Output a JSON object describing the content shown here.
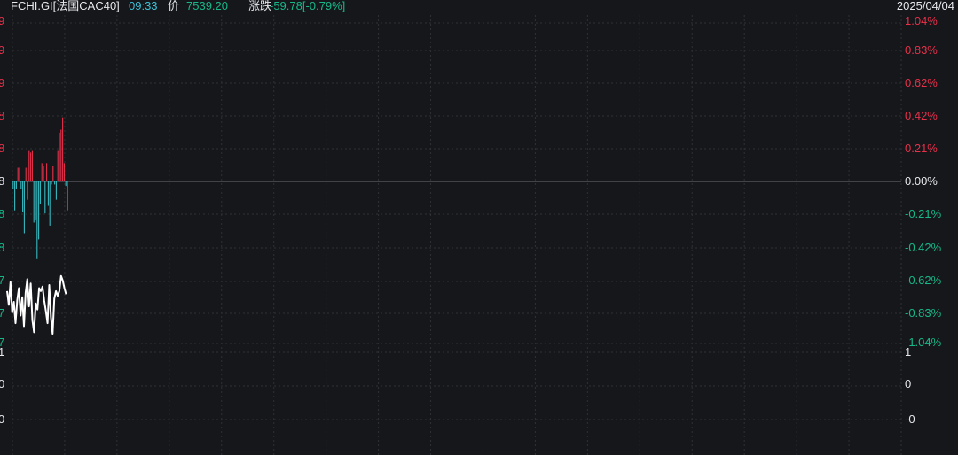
{
  "header": {
    "symbol": "FCHI.GI[法国CAC40]",
    "time": "09:33",
    "price_label": "价",
    "price": "7539.20",
    "change_label": "涨跌",
    "change": "-59.78[-0.79%]",
    "date": "2025/04/04"
  },
  "colors": {
    "background": "#16171b",
    "up": "#e8304a",
    "down": "#16b889",
    "down_bar": "#36b8c0",
    "time_text": "#3bc1d6",
    "line": "#ffffff",
    "grid": "#2e3036"
  },
  "axis": {
    "right_pct_labels": [
      {
        "text": "1.04%",
        "dir": "up"
      },
      {
        "text": "0.83%",
        "dir": "up"
      },
      {
        "text": "0.62%",
        "dir": "up"
      },
      {
        "text": "0.42%",
        "dir": "up"
      },
      {
        "text": "0.21%",
        "dir": "up"
      },
      {
        "text": "0.00%",
        "dir": "flat"
      },
      {
        "text": "-0.21%",
        "dir": "down"
      },
      {
        "text": "-0.42%",
        "dir": "down"
      },
      {
        "text": "-0.62%",
        "dir": "down"
      },
      {
        "text": "-0.83%",
        "dir": "down"
      },
      {
        "text": "-1.04%",
        "dir": "down"
      }
    ],
    "left_price_tails": [
      "9",
      "9",
      "9",
      "8",
      "8",
      "8",
      "8",
      "8",
      "7",
      "7",
      "7"
    ],
    "volume_labels_right": [
      "1",
      "0",
      "-0"
    ],
    "volume_labels_left": [
      "1",
      "0",
      "0"
    ]
  },
  "chart_data": {
    "type": "line",
    "symbol": "FCHI.GI",
    "last_price": 7539.2,
    "change": -59.78,
    "change_pct": -0.79,
    "y_pct_range": [
      -1.04,
      1.04
    ],
    "price_line_pct": [
      -0.72,
      -0.81,
      -0.66,
      -0.86,
      -0.79,
      -0.93,
      -0.78,
      -0.7,
      -0.88,
      -0.76,
      -0.95,
      -0.73,
      -0.64,
      -0.82,
      -0.67,
      -0.91,
      -0.99,
      -0.8,
      -0.84,
      -0.7,
      -0.72,
      -0.69,
      -0.78,
      -0.85,
      -0.93,
      -0.68,
      -0.89,
      -1.0,
      -0.77,
      -0.72,
      -0.75,
      -0.72,
      -0.62,
      -0.65,
      -0.7,
      -0.74
    ],
    "bars_pct": [
      0.0,
      -0.05,
      -0.19,
      -0.05,
      0.09,
      0.09,
      -0.05,
      -0.2,
      -0.34,
      0.09,
      -0.12,
      0.2,
      0.19,
      0.2,
      -0.27,
      -0.25,
      -0.51,
      -0.38,
      -0.15,
      0.12,
      0.1,
      -0.21,
      0.12,
      -0.16,
      -0.29,
      -0.02,
      0.1,
      -0.02,
      -0.12,
      0.2,
      0.32,
      0.34,
      0.42,
      0.12,
      -0.03,
      -0.19
    ]
  }
}
